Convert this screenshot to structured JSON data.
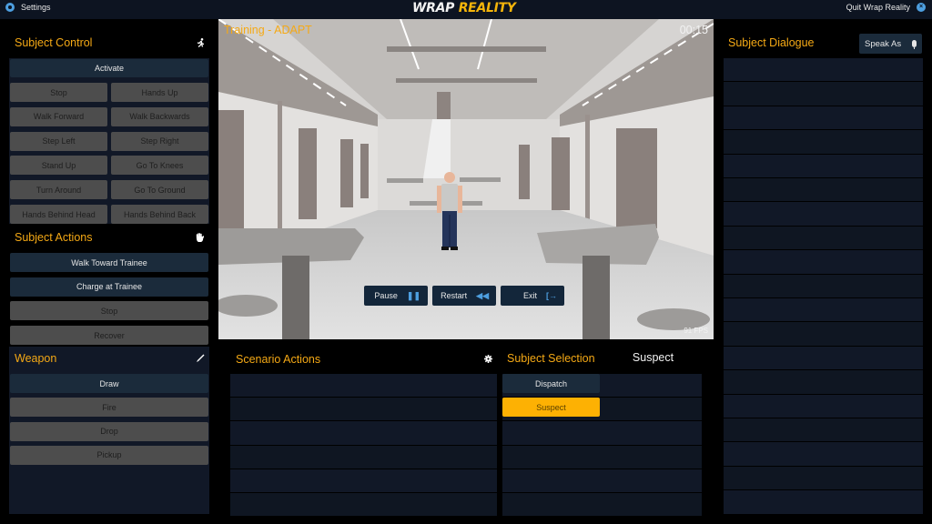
{
  "topbar": {
    "settings_label": "Settings",
    "settings_icon": "gear-icon",
    "logo_part1": "WRAP",
    "logo_part2": "REALITY",
    "quit_label": "Quit Wrap Reality",
    "quit_icon": "close-circle-icon"
  },
  "colors": {
    "accent_orange": "#f5a915",
    "selected_yellow": "#fdb103",
    "icon_blue": "#4d9fe0",
    "button_dark": "#1b2b3b",
    "button_disabled": "#4d4d4d",
    "panel_bg": "#111827"
  },
  "subject_control": {
    "title": "Subject Control",
    "icon": "running-person-icon",
    "activate_label": "Activate",
    "buttons": [
      [
        "Stop",
        "Hands Up"
      ],
      [
        "Walk Forward",
        "Walk Backwards"
      ],
      [
        "Step Left",
        "Step Right"
      ],
      [
        "Stand Up",
        "Go To Knees"
      ],
      [
        "Turn Around",
        "Go To Ground"
      ],
      [
        "Hands Behind Head",
        "Hands Behind Back"
      ]
    ]
  },
  "subject_actions": {
    "title": "Subject Actions",
    "icon": "hand-icon",
    "buttons": [
      {
        "label": "Walk Toward Trainee",
        "state": "enabled"
      },
      {
        "label": "Charge at Trainee",
        "state": "enabled"
      },
      {
        "label": "Stop",
        "state": "disabled"
      },
      {
        "label": "Recover",
        "state": "disabled"
      }
    ]
  },
  "weapon": {
    "title": "Weapon",
    "icon": "knife-icon",
    "buttons": [
      {
        "label": "Draw",
        "state": "enabled"
      },
      {
        "label": "Fire",
        "state": "disabled"
      },
      {
        "label": "Drop",
        "state": "disabled"
      },
      {
        "label": "Pickup",
        "state": "disabled"
      }
    ]
  },
  "viewport": {
    "title": "Training - ADAPT",
    "timer": "00:15",
    "fps": "91 FPS",
    "controls": [
      {
        "label": "Pause",
        "icon": "pause-icon",
        "glyph": "❚❚"
      },
      {
        "label": "Restart",
        "icon": "rewind-icon",
        "glyph": "◀◀"
      },
      {
        "label": "Exit",
        "icon": "exit-icon",
        "glyph": "[→"
      }
    ]
  },
  "scenario_actions": {
    "title": "Scenario Actions",
    "icon": "gear-icon",
    "items": []
  },
  "subject_selection": {
    "title": "Subject Selection",
    "current": "Suspect",
    "options": [
      {
        "label": "Dispatch",
        "selected": false
      },
      {
        "label": "Suspect",
        "selected": true
      }
    ]
  },
  "subject_dialogue": {
    "title": "Subject Dialogue",
    "speak_as_label": "Speak As",
    "speak_as_icon": "microphone-icon",
    "items": []
  }
}
